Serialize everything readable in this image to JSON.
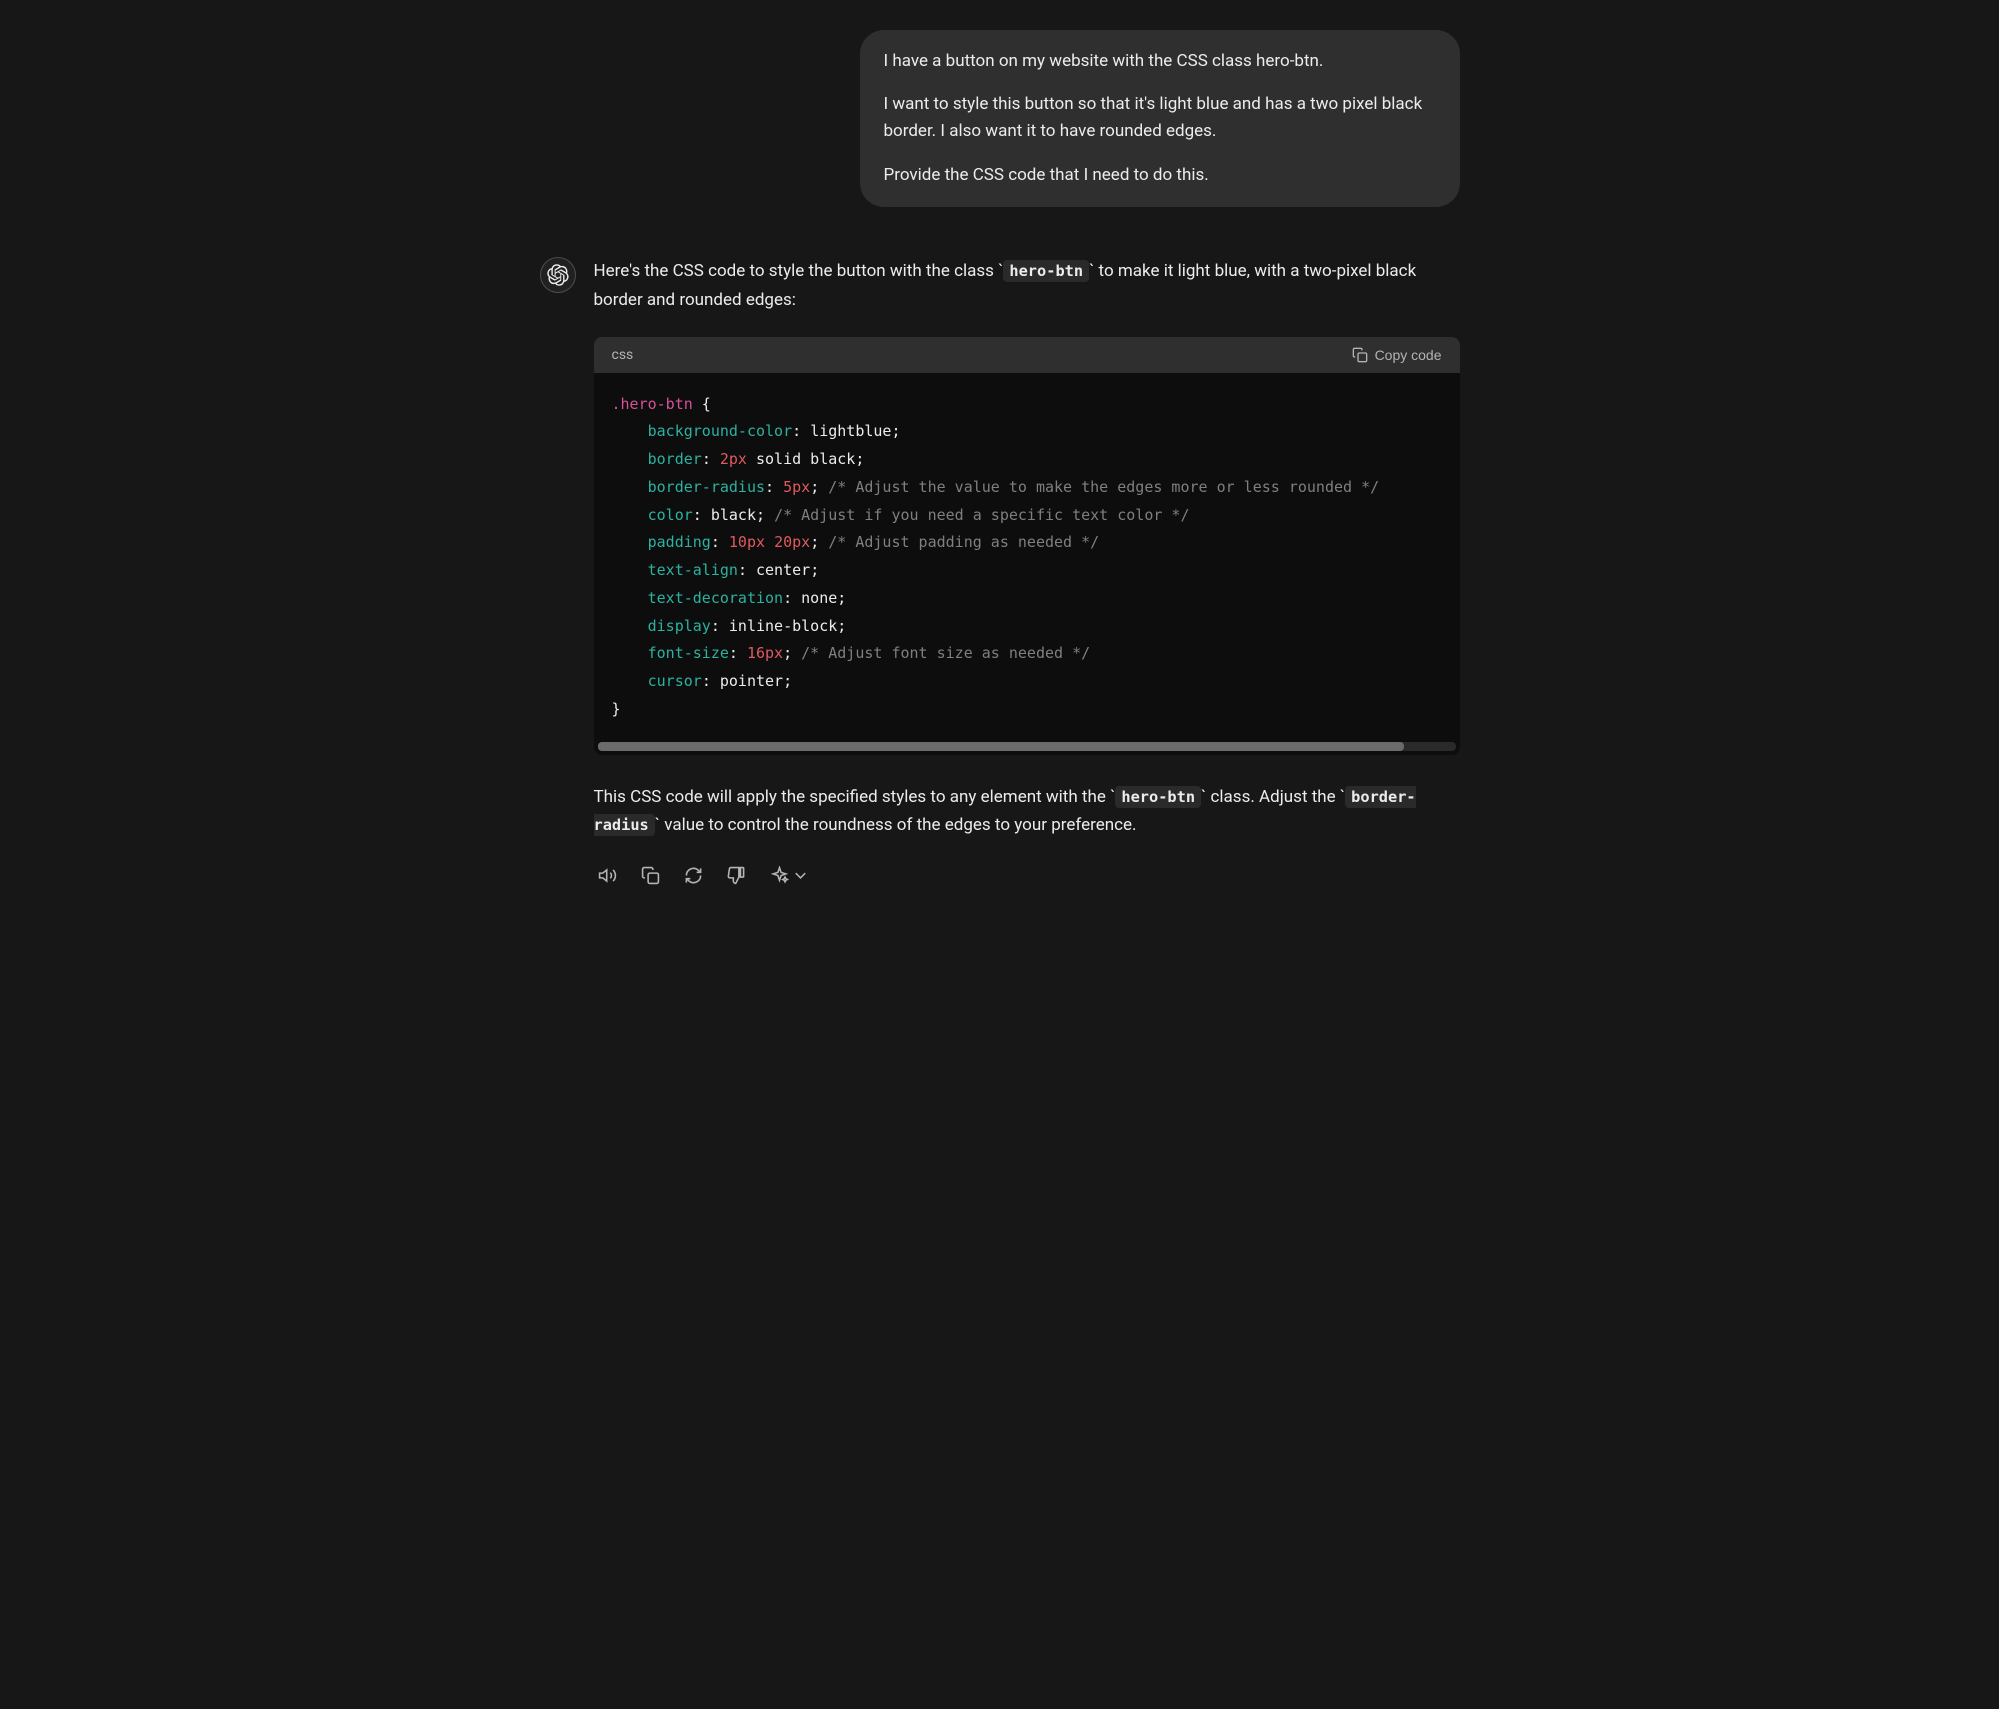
{
  "user_message": {
    "p1": "I have a button on my website with the CSS class hero-btn.",
    "p2": "I want to style this button so that it's light blue and has a two pixel black border. I also want it to have rounded edges.",
    "p3": "Provide the CSS code that I need to do this."
  },
  "assistant": {
    "intro_before": "Here's the CSS code to style the button with the class ",
    "intro_code": "hero-btn",
    "intro_after": " to make it light blue, with a two-pixel black border and rounded edges:",
    "outro_before": "This CSS code will apply the specified styles to any element with the ",
    "outro_code1": "hero-btn",
    "outro_mid": " class. Adjust the ",
    "outro_code2": "border-radius",
    "outro_after": " value to control the roundness of the edges to your preference."
  },
  "code": {
    "lang": "css",
    "copy_label": "Copy code",
    "selector": ".hero-btn",
    "brace_open": " {",
    "brace_close": "}",
    "lines": {
      "l1_prop": "background-color",
      "l1_val": "lightblue",
      "l2_prop": "border",
      "l2_num": "2px",
      "l2_val": "solid black",
      "l3_prop": "border-radius",
      "l3_num": "5px",
      "l3_comment": "/* Adjust the value to make the edges more or less rounded */",
      "l4_prop": "color",
      "l4_val": "black",
      "l4_comment": "/* Adjust if you need a specific text color */",
      "l5_prop": "padding",
      "l5_num1": "10px",
      "l5_num2": "20px",
      "l5_comment": "/* Adjust padding as needed */",
      "l6_prop": "text-align",
      "l6_val": "center",
      "l7_prop": "text-decoration",
      "l7_val": "none",
      "l8_prop": "display",
      "l8_val": "inline-block",
      "l9_prop": "font-size",
      "l9_num": "16px",
      "l9_comment": "/* Adjust font size as needed */",
      "l10_prop": "cursor",
      "l10_val": "pointer"
    }
  }
}
